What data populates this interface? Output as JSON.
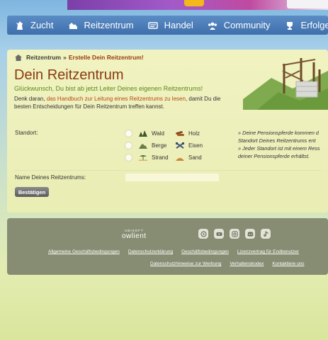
{
  "nav": {
    "items": [
      {
        "label": "Zucht",
        "icon": "horse-head-icon"
      },
      {
        "label": "Reitzentrum",
        "icon": "stable-icon"
      },
      {
        "label": "Handel",
        "icon": "trade-icon"
      },
      {
        "label": "Community",
        "icon": "community-icon"
      },
      {
        "label": "Erfolge",
        "icon": "trophy-icon"
      }
    ]
  },
  "breadcrumb": {
    "home": "Reitzentrum",
    "separator": "»",
    "current": "Erstelle Dein Reitzentrum!"
  },
  "page": {
    "title": "Dein Reitzentrum",
    "subtitle": "Glückwunsch, Du bist ab jetzt Leiter Deines eigenen Reitzentrums!",
    "intro_before": "Denk daran, ",
    "intro_link": "das Handbuch zur Leitung eines Reitzentrums zu lesen",
    "intro_after": ", damit Du die besten Entscheidungen für Dein Reitzentrum treffen kannst."
  },
  "form": {
    "location_label": "Standort:",
    "locations": [
      {
        "label": "Wald",
        "resource": "Holz",
        "location_icon": "forest-icon",
        "resource_icon": "wood-icon"
      },
      {
        "label": "Berge",
        "resource": "Eisen",
        "location_icon": "mountain-icon",
        "resource_icon": "iron-icon"
      },
      {
        "label": "Strand",
        "resource": "Sand",
        "location_icon": "beach-icon",
        "resource_icon": "sand-icon"
      }
    ],
    "info_lines": [
      "» Deine Pensionspferde kommen d",
      "Standort Deines Reitzentrums ent",
      "» Jeder Standort ist mit einem Ress",
      "deiner Pensionspferde erhältst."
    ],
    "name_label": "Name Deines Reitzentrums:",
    "name_value": "",
    "submit_label": "Bestätigen"
  },
  "footer": {
    "brand_small": "UBISOFT",
    "brand_big": "owlient",
    "social": [
      "instagram-like-icon",
      "youtube-icon",
      "instagram-icon",
      "discord-icon",
      "tiktok-icon"
    ],
    "links_row1": [
      "Allgemeine Geschäftsbedingungen",
      "Datenschutzerklärung",
      "Geschäftsbedingungen",
      "Lizenzvertrag für Endbenutzer"
    ],
    "links_row2": [
      "Datenschutzhinweise zur Werbung",
      "Verhaltenskodex",
      "Kontaktiere uns"
    ]
  },
  "colors": {
    "nav": "#4a7bb8",
    "title": "#8a3a12",
    "subtitle": "#5a8a1e",
    "link": "#b34a14",
    "footer": "#868d72"
  }
}
